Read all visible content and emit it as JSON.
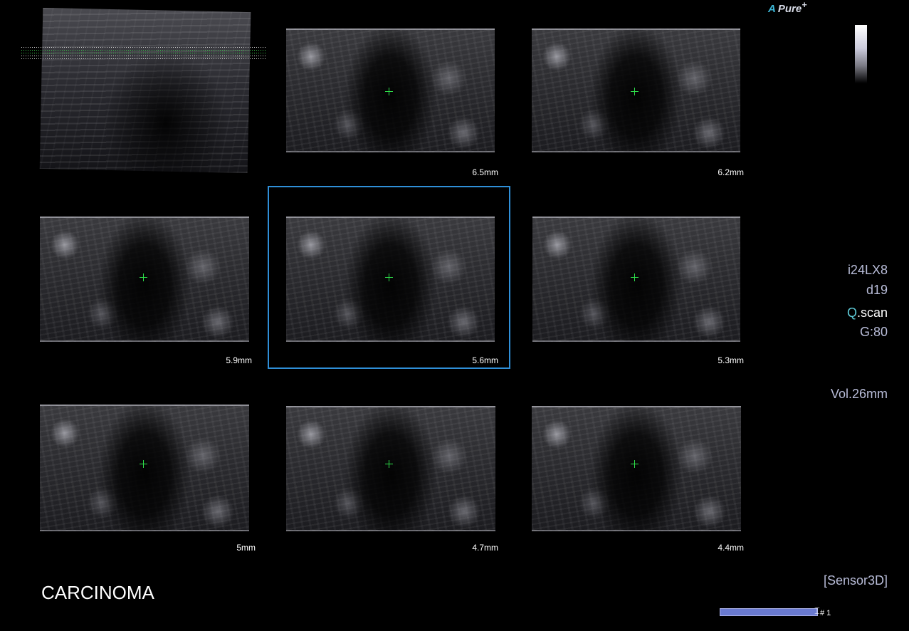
{
  "brand": {
    "logo_mark": "A",
    "logo_text": "Pure",
    "logo_sup": "+"
  },
  "probe": {
    "model": "i24LX8",
    "depth": "d19",
    "mode_prefix": "Q",
    "mode_suffix": ".scan",
    "gain": "G:80"
  },
  "volume": "Vol.26mm",
  "sensor": "[Sensor3D]",
  "annotation": "CARCINOMA",
  "cine": {
    "frame": "# 1"
  },
  "slices": [
    {
      "depth_label": "6.5mm"
    },
    {
      "depth_label": "6.2mm"
    },
    {
      "depth_label": "5.9mm"
    },
    {
      "depth_label": "5.6mm",
      "selected": true
    },
    {
      "depth_label": "5.3mm"
    },
    {
      "depth_label": "5mm"
    },
    {
      "depth_label": "4.7mm"
    },
    {
      "depth_label": "4.4mm"
    }
  ],
  "colors": {
    "crosshair": "#2ee04a",
    "selection": "#2f8fd8",
    "info_text": "#b8bcd8",
    "accent": "#5ecbd8"
  }
}
